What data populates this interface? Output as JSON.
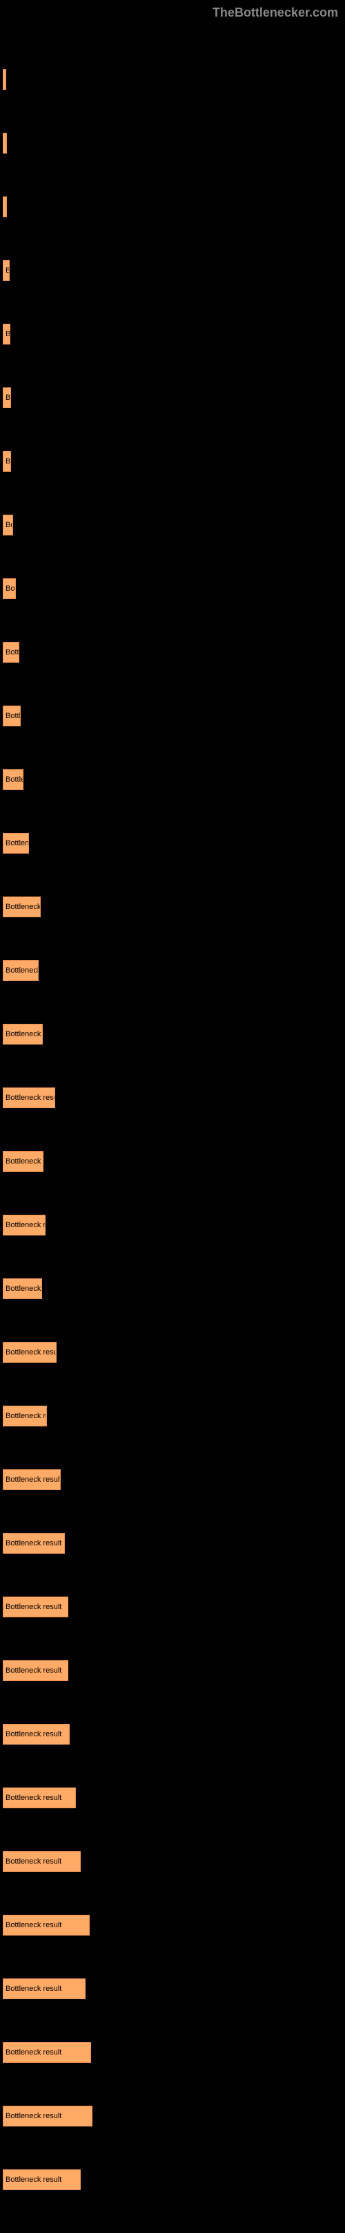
{
  "watermark": "TheBottlenecker.com",
  "chart_data": {
    "type": "bar",
    "title": "",
    "xlabel": "",
    "ylabel": "",
    "label_template": "Bottleneck result",
    "bars": [
      {
        "width": 5
      },
      {
        "width": 6
      },
      {
        "width": 6
      },
      {
        "width": 10
      },
      {
        "width": 11
      },
      {
        "width": 12
      },
      {
        "width": 12
      },
      {
        "width": 15
      },
      {
        "width": 19
      },
      {
        "width": 24
      },
      {
        "width": 26
      },
      {
        "width": 30
      },
      {
        "width": 38
      },
      {
        "width": 55
      },
      {
        "width": 52
      },
      {
        "width": 58
      },
      {
        "width": 76
      },
      {
        "width": 59
      },
      {
        "width": 62
      },
      {
        "width": 57
      },
      {
        "width": 78
      },
      {
        "width": 64
      },
      {
        "width": 84
      },
      {
        "width": 90
      },
      {
        "width": 95
      },
      {
        "width": 95
      },
      {
        "width": 97
      },
      {
        "width": 106
      },
      {
        "width": 113
      },
      {
        "width": 126
      },
      {
        "width": 120
      },
      {
        "width": 128
      },
      {
        "width": 130
      },
      {
        "width": 113
      }
    ]
  }
}
